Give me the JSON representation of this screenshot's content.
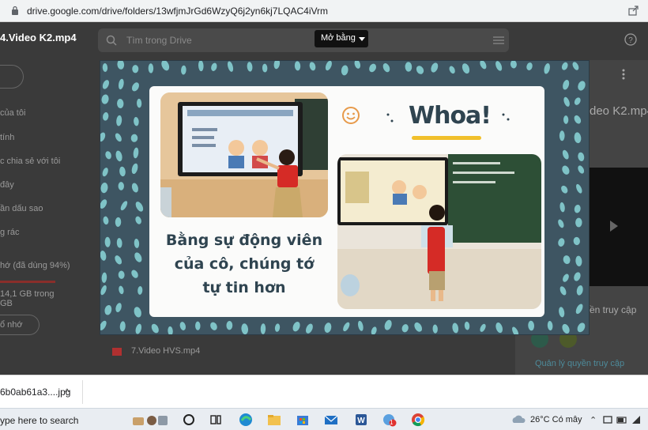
{
  "browser": {
    "url": "drive.google.com/drive/folders/13wfjmJrGd6WzyQ6j2yn6kj7LQAC4iVrm"
  },
  "drive": {
    "file_title": "4.Video K2.mp4",
    "search_placeholder": "Tìm trong Drive",
    "open_with_label": "Mở bằng",
    "sidebar": [
      "của tôi",
      "tính",
      "c chia sẻ với tôi",
      "đây",
      "ần dấu sao",
      "g rác",
      "hớ (đã dùng 94%)",
      "14,1 GB trong",
      "GB",
      "ổ nhớ"
    ],
    "list_file": "7.Video HVS.mp4",
    "right_panel": {
      "title": "deo K2.mp4",
      "access": "ền truy cập",
      "manage": "Quản lý quyền truy cập"
    }
  },
  "video": {
    "caption_lines": [
      "Bằng sự động viên",
      "của cô, chúng tớ",
      "tự tin hơn"
    ],
    "exclaim": "Whoa!"
  },
  "download_shelf": {
    "file": "6b0ab61a3....jpg"
  },
  "taskbar": {
    "search": "ype here to search",
    "weather": "26°C  Có mây",
    "mail_badge": "1"
  },
  "colors": {
    "video_bg": "#3e5562",
    "dot": "#7fc3c7",
    "accent_yellow": "#f1c02b",
    "text_dark": "#2f4450"
  }
}
